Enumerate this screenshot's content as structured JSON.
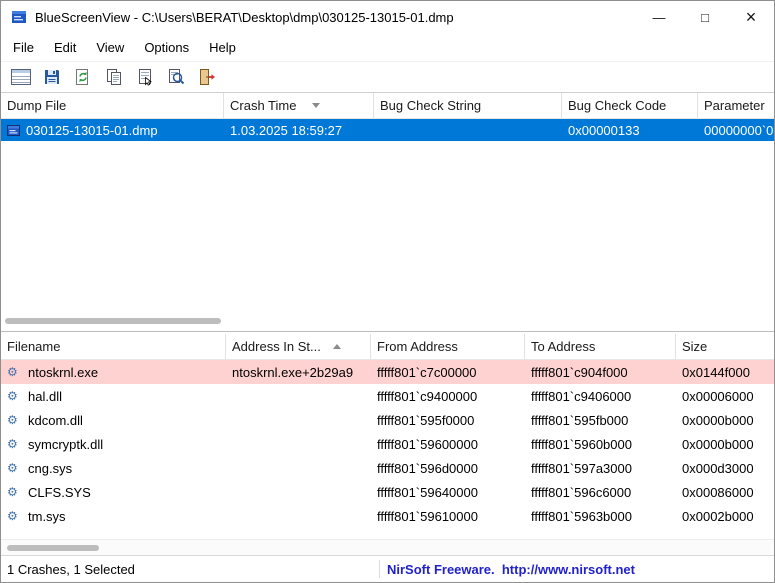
{
  "window": {
    "title": "BlueScreenView  -  C:\\Users\\BERAT\\Desktop\\dmp\\030125-13015-01.dmp",
    "controls": {
      "minimize": "—",
      "maximize": "□",
      "close": "×"
    }
  },
  "menu": {
    "items": [
      "File",
      "Edit",
      "View",
      "Options",
      "Help"
    ]
  },
  "toolbar": {
    "buttons": [
      "report",
      "save",
      "refresh",
      "copy",
      "properties",
      "find",
      "exit"
    ]
  },
  "icons": {
    "driver_glyph": "⚙"
  },
  "upper_table": {
    "columns": [
      "Dump File",
      "Crash Time",
      "Bug Check String",
      "Bug Check Code",
      "Parameter"
    ],
    "sort": {
      "column": "Crash Time",
      "direction": "desc"
    },
    "rows": [
      {
        "dump_file": "030125-13015-01.dmp",
        "crash_time": "1.03.2025 18:59:27",
        "bug_check_string": "",
        "bug_check_code": "0x00000133",
        "parameter_1": "00000000`0",
        "selected": true
      }
    ]
  },
  "lower_table": {
    "columns": [
      "Filename",
      "Address In St...",
      "From Address",
      "To Address",
      "Size"
    ],
    "sort": {
      "column": "Address In St...",
      "direction": "asc"
    },
    "rows": [
      {
        "filename": "ntoskrnl.exe",
        "address_in_stack": "ntoskrnl.exe+2b29a9",
        "from_address": "fffff801`c7c00000",
        "to_address": "fffff801`c904f000",
        "size": "0x0144f000",
        "highlighted": true
      },
      {
        "filename": "hal.dll",
        "address_in_stack": "",
        "from_address": "fffff801`c9400000",
        "to_address": "fffff801`c9406000",
        "size": "0x00006000",
        "highlighted": false
      },
      {
        "filename": "kdcom.dll",
        "address_in_stack": "",
        "from_address": "fffff801`595f0000",
        "to_address": "fffff801`595fb000",
        "size": "0x0000b000",
        "highlighted": false
      },
      {
        "filename": "symcryptk.dll",
        "address_in_stack": "",
        "from_address": "fffff801`59600000",
        "to_address": "fffff801`5960b000",
        "size": "0x0000b000",
        "highlighted": false
      },
      {
        "filename": "cng.sys",
        "address_in_stack": "",
        "from_address": "fffff801`596d0000",
        "to_address": "fffff801`597a3000",
        "size": "0x000d3000",
        "highlighted": false
      },
      {
        "filename": "CLFS.SYS",
        "address_in_stack": "",
        "from_address": "fffff801`59640000",
        "to_address": "fffff801`596c6000",
        "size": "0x00086000",
        "highlighted": false
      },
      {
        "filename": "tm.sys",
        "address_in_stack": "",
        "from_address": "fffff801`59610000",
        "to_address": "fffff801`5963b000",
        "size": "0x0002b000",
        "highlighted": false
      }
    ]
  },
  "statusbar": {
    "left": "1 Crashes, 1 Selected",
    "nirsoft": "NirSoft Freeware.  http://www.nirsoft.net"
  }
}
